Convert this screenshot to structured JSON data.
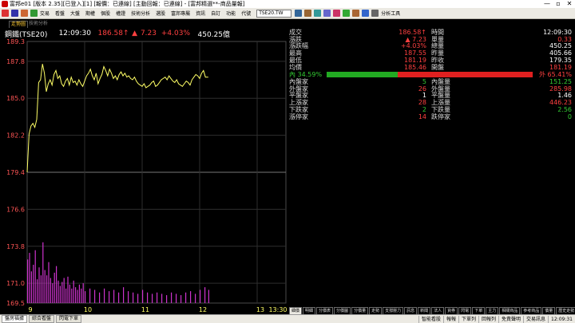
{
  "window": {
    "title": "富邦e01 [版本 2.35][已登入][1] [報價：已連線] [主動回報：已連線] - [富邦精選**-商品量報]",
    "controls": [
      "—",
      "▫",
      "✕"
    ]
  },
  "menubar": {
    "items": [
      "交易",
      "看盤",
      "大盤",
      "期權",
      "個股",
      "權證",
      "技術分析",
      "選股",
      "富邦專屬",
      "資訊",
      "自訂",
      "功能"
    ],
    "ticker_label": "代號",
    "ticker_value": "TSE20.TW",
    "extra": "分析工具"
  },
  "tabs": {
    "active": "走勢圖",
    "inactive": "技術分析"
  },
  "header": {
    "name": "鋼鐵(TSE20)",
    "time": "12:09:30",
    "price": "186.58",
    "arrow": "↑",
    "triangle": "▲",
    "change": "7.23",
    "pct": "+4.03%",
    "volume": "450.25億"
  },
  "chart_data": {
    "type": "line",
    "title": "",
    "price_axis": {
      "ticks": [
        "189.3",
        "187.8",
        "185.0",
        "182.2",
        "179.4",
        "176.6",
        "173.8",
        "171.0",
        "169.5"
      ],
      "min": 169.5,
      "max": 189.3
    },
    "ref_price": 179.4,
    "time_axis": {
      "ticks": [
        "9",
        "10",
        "11",
        "12",
        "13",
        "13:30"
      ],
      "start_min": 540,
      "end_min": 810
    },
    "series": [
      {
        "kind": "price",
        "color": "#ffff66",
        "x": [
          540,
          542,
          544,
          546,
          548,
          550,
          552,
          554,
          556,
          558,
          560,
          562,
          564,
          566,
          568,
          570,
          572,
          574,
          576,
          578,
          580,
          582,
          584,
          586,
          588,
          590,
          592,
          594,
          596,
          598,
          600,
          602,
          604,
          606,
          608,
          610,
          612,
          614,
          616,
          618,
          620,
          622,
          624,
          626,
          628,
          630,
          632,
          634,
          636,
          638,
          640,
          642,
          644,
          646,
          648,
          650,
          652,
          654,
          656,
          658,
          660,
          662,
          664,
          666,
          668,
          670,
          672,
          674,
          676,
          678,
          680,
          682,
          684,
          686,
          688,
          690,
          692,
          694,
          696,
          698,
          700,
          702,
          704,
          706,
          708,
          710,
          712,
          714,
          716,
          718,
          720,
          722,
          724,
          726,
          728,
          729
        ],
        "y": [
          179.4,
          182.3,
          182.9,
          183.1,
          182.8,
          183.4,
          186.2,
          186.4,
          187.6,
          186.9,
          185.5,
          186.1,
          186.4,
          186.0,
          186.8,
          187.1,
          186.5,
          186.7,
          186.1,
          185.9,
          186.3,
          186.5,
          186.0,
          186.6,
          186.2,
          186.3,
          186.0,
          186.4,
          186.1,
          185.9,
          186.3,
          186.7,
          186.9,
          187.2,
          186.7,
          186.4,
          186.9,
          186.1,
          186.5,
          186.8,
          187.4,
          187.1,
          186.7,
          187.2,
          186.9,
          186.5,
          186.7,
          186.4,
          186.8,
          187.0,
          186.7,
          186.9,
          186.6,
          186.7,
          186.5,
          186.4,
          186.6,
          186.3,
          186.1,
          186.0,
          185.9,
          186.1,
          185.8,
          185.9,
          186.0,
          186.2,
          186.3,
          185.9,
          186.0,
          186.2,
          186.4,
          186.5,
          186.6,
          186.4,
          186.7,
          186.5,
          186.3,
          186.2,
          186.4,
          186.1,
          186.0,
          185.9,
          186.1,
          186.3,
          186.2,
          186.0,
          186.4,
          186.6,
          186.8,
          186.7,
          186.5,
          186.9,
          187.1,
          186.6,
          186.6,
          186.6
        ]
      },
      {
        "kind": "volume",
        "color": "#cc33cc",
        "max": 173.8,
        "min": 169.5,
        "x": [
          540,
          542,
          544,
          546,
          548,
          550,
          552,
          554,
          556,
          558,
          560,
          562,
          564,
          566,
          568,
          570,
          572,
          574,
          576,
          578,
          580,
          582,
          584,
          586,
          588,
          590,
          592,
          594,
          596,
          598,
          600,
          605,
          610,
          615,
          620,
          625,
          630,
          635,
          640,
          645,
          650,
          655,
          660,
          665,
          670,
          675,
          680,
          685,
          690,
          695,
          700,
          705,
          710,
          715,
          720,
          725,
          729
        ],
        "y": [
          172.8,
          173.3,
          171.9,
          172.4,
          173.5,
          171.3,
          172.2,
          171.6,
          174.1,
          172.0,
          171.6,
          172.6,
          171.4,
          171.0,
          171.8,
          172.3,
          171.2,
          170.8,
          171.1,
          171.4,
          170.6,
          171.5,
          170.9,
          170.6,
          171.2,
          170.7,
          170.5,
          170.9,
          170.6,
          171.0,
          170.4,
          170.6,
          170.5,
          170.3,
          170.6,
          170.4,
          170.5,
          170.3,
          170.7,
          170.4,
          170.3,
          170.2,
          170.5,
          170.3,
          170.2,
          170.3,
          170.2,
          170.1,
          170.3,
          170.2,
          170.1,
          170.3,
          170.4,
          170.2,
          170.5,
          170.7,
          170.5
        ]
      }
    ]
  },
  "quote": {
    "rows": [
      {
        "l1": "成交",
        "v1": "186.58↑",
        "c1": "#ff4040",
        "l2": "時間",
        "v2": "12:09:30",
        "c2": "#ffffff"
      },
      {
        "l1": "漲跌",
        "v1": "▲ 7.23",
        "c1": "#ff4040",
        "l2": "單量",
        "v2": "0.33",
        "c2": "#ff4040"
      },
      {
        "l1": "漲跌幅",
        "v1": "+4.03%",
        "c1": "#ff4040",
        "l2": "總量",
        "v2": "450.25",
        "c2": "#ffffff"
      },
      {
        "l1": "最高",
        "v1": "187.55",
        "c1": "#ff4040",
        "l2": "昨量",
        "v2": "405.66",
        "c2": "#ffffff"
      },
      {
        "l1": "最低",
        "v1": "181.19",
        "c1": "#ff4040",
        "l2": "昨收",
        "v2": "179.35",
        "c2": "#ffffff"
      },
      {
        "l1": "均價",
        "v1": "185.46",
        "c1": "#ff4040",
        "l2": "開盤",
        "v2": "181.19",
        "c2": "#ff4040"
      }
    ],
    "bar": {
      "left": "內 34.59%",
      "right": "外 65.41%",
      "green": 34.59
    },
    "rows2": [
      {
        "l1": "內盤家",
        "v1": "5",
        "c1": "#33cc33",
        "l2": "內盤量",
        "v2": "151.25",
        "c2": "#33cc33"
      },
      {
        "l1": "外盤家",
        "v1": "26",
        "c1": "#ff4040",
        "l2": "外盤量",
        "v2": "285.98",
        "c2": "#ff4040"
      },
      {
        "l1": "平盤家",
        "v1": "1",
        "c1": "#ffffff",
        "l2": "平盤量",
        "v2": "1.46",
        "c2": "#ffffff"
      },
      {
        "l1": "上漲家",
        "v1": "28",
        "c1": "#ff4040",
        "l2": "上漲量",
        "v2": "446.23",
        "c2": "#ff4040"
      },
      {
        "l1": "下跌家",
        "v1": "2",
        "c1": "#33cc33",
        "l2": "下跌量",
        "v2": "2.56",
        "c2": "#33cc33"
      },
      {
        "l1": "漲停家",
        "v1": "14",
        "c1": "#ff4040",
        "l2": "跌停家",
        "v2": "0",
        "c2": "#33cc33"
      }
    ]
  },
  "bottom_tabs": [
    "細價",
    "明細",
    "分價表",
    "分價圖",
    "分價量",
    "走勢",
    "支撐壓力",
    "訊息",
    "新聞",
    "法人",
    "資券",
    "閃電",
    "下單",
    "主力",
    "相關商品",
    "參考商品",
    "價量",
    "歷史走勢"
  ],
  "statusbar": {
    "buttons": [
      "盤房福據",
      "綜合看盤",
      "閃電下單"
    ],
    "right": [
      "智能看股",
      "報報",
      "下單列",
      "回報列",
      "免責聲明",
      "交易訊息",
      "12:09:31"
    ]
  }
}
